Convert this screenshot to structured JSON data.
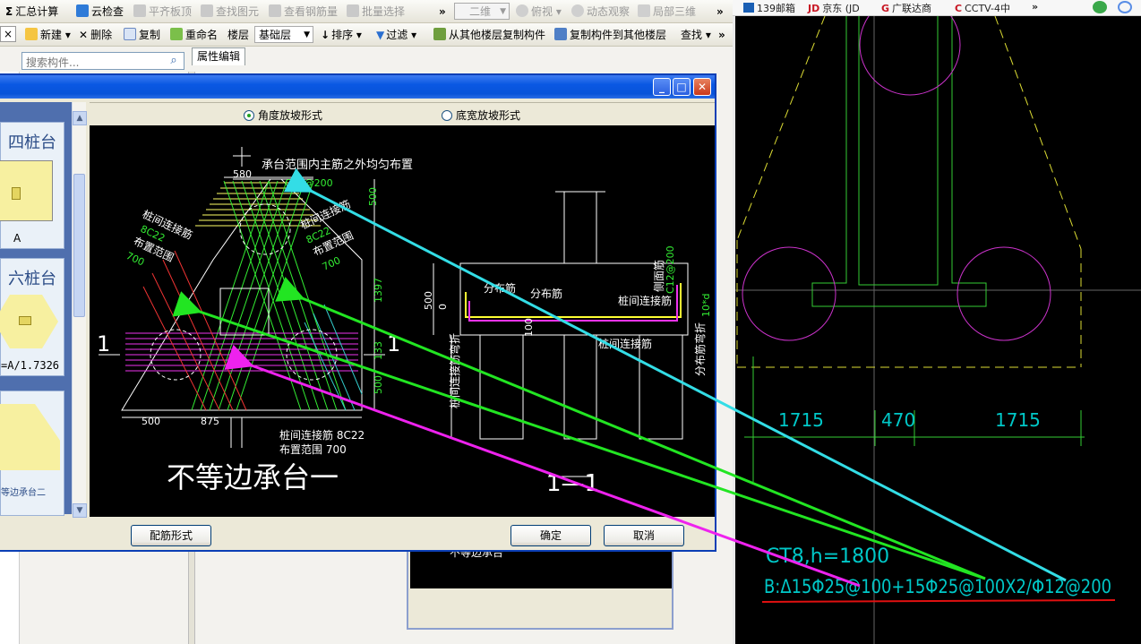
{
  "toolbar1": {
    "items": [
      {
        "name": "sum-icon",
        "label": "汇总计算",
        "enabled": true
      },
      {
        "name": "cloud-check-icon",
        "label": "云检查",
        "enabled": true
      },
      {
        "name": "flat-board-icon",
        "label": "平齐板顶",
        "enabled": false
      },
      {
        "name": "find-element-icon",
        "label": "查找图元",
        "enabled": false
      },
      {
        "name": "view-rebar-icon",
        "label": "查看钢筋量",
        "enabled": false
      },
      {
        "name": "batch-select-icon",
        "label": "批量选择",
        "enabled": false
      }
    ],
    "view_mode": "二维",
    "view_items": [
      {
        "label": "俯视",
        "enabled": false
      },
      {
        "label": "动态观察",
        "enabled": false
      },
      {
        "label": "局部三维",
        "enabled": false
      }
    ]
  },
  "toolbar2": {
    "close_label": "×",
    "new_label": "新建",
    "delete_label": "删除",
    "copy_label": "复制",
    "rename_label": "重命名",
    "floor_label": "楼层",
    "floor_value": "基础层",
    "sort_label": "排序",
    "filter_label": "过滤",
    "copy_from_label": "从其他楼层复制构件",
    "copy_to_label": "复制构件到其他楼层",
    "find_label": "查找"
  },
  "search": {
    "placeholder": "搜索构件..."
  },
  "property_tab": "属性编辑",
  "dialog": {
    "thumbs": [
      {
        "title": "四桩台",
        "sub": "A"
      },
      {
        "title": "六桩台",
        "sub": "=A/1.7326"
      },
      {
        "title": "",
        "sub": "等边承台二"
      }
    ],
    "radio_angle": "角度放坡形式",
    "radio_width": "底宽放坡形式",
    "selected_radio": "angle",
    "rebar_form_button": "配筋形式",
    "ok_button": "确定",
    "cancel_button": "取消"
  },
  "drawing": {
    "main_title": "不等边承台一",
    "section_title": "1—1",
    "top_note": "承台范围内主筋之外均匀布置",
    "top_rebar": "C12@200",
    "dim_580": "580",
    "dim_500": "500",
    "dim_1397": "1397",
    "dim_133": "133",
    "dim_500b": "500",
    "dim_bottom_500": "500",
    "dim_bottom_875": "875",
    "left_label1": "桩间连接筋",
    "left_label2": "8C22",
    "left_label3": "布置范围",
    "left_label4": "700",
    "right_label1": "桩间连接筋",
    "right_label2": "8C22",
    "right_label3": "布置范围",
    "right_label4": "700",
    "bottom_label1": "桩间连接筋 8C22",
    "bottom_label2": "布置范围 700",
    "section_mark_left": "1",
    "section_mark_right": "1",
    "sec_dist1": "分布筋",
    "sec_dist2": "分布筋",
    "sec_side": "侧面筋",
    "sec_side_rebar": "C12@200",
    "sec_conn1": "桩间连接筋",
    "sec_conn2": "桩间连接筋",
    "sec_left_bend": "桩间连接筋弯折",
    "sec_right_bend": "分布筋弯折",
    "sec_10d": "10*d",
    "sec_500": "500",
    "sec_0": "0",
    "sec_100": "100"
  },
  "lower_panel_text": "不等边承台",
  "browser_bookmarks": [
    {
      "label": "139邮箱",
      "color": "#1a5fb4"
    },
    {
      "label": "京东 (JD",
      "color": "#c81623"
    },
    {
      "label": "广联达商",
      "color": "#c81623"
    },
    {
      "label": "CCTV-4中",
      "color": "#c81623"
    }
  ],
  "cad": {
    "dim1": "1715",
    "dim2": "470",
    "dim3": "1715",
    "label1": "CT8,h=1800",
    "label2": "B:Δ15Φ25@100+15Φ25@100X2/Φ12@200"
  },
  "colors": {
    "titlebar": "#0a58e3",
    "cad_text": "#00c8c8",
    "arrow_cyan": "#33dde6",
    "arrow_green": "#22e522",
    "arrow_magenta": "#ee22ee",
    "underline_red": "#e01010"
  }
}
